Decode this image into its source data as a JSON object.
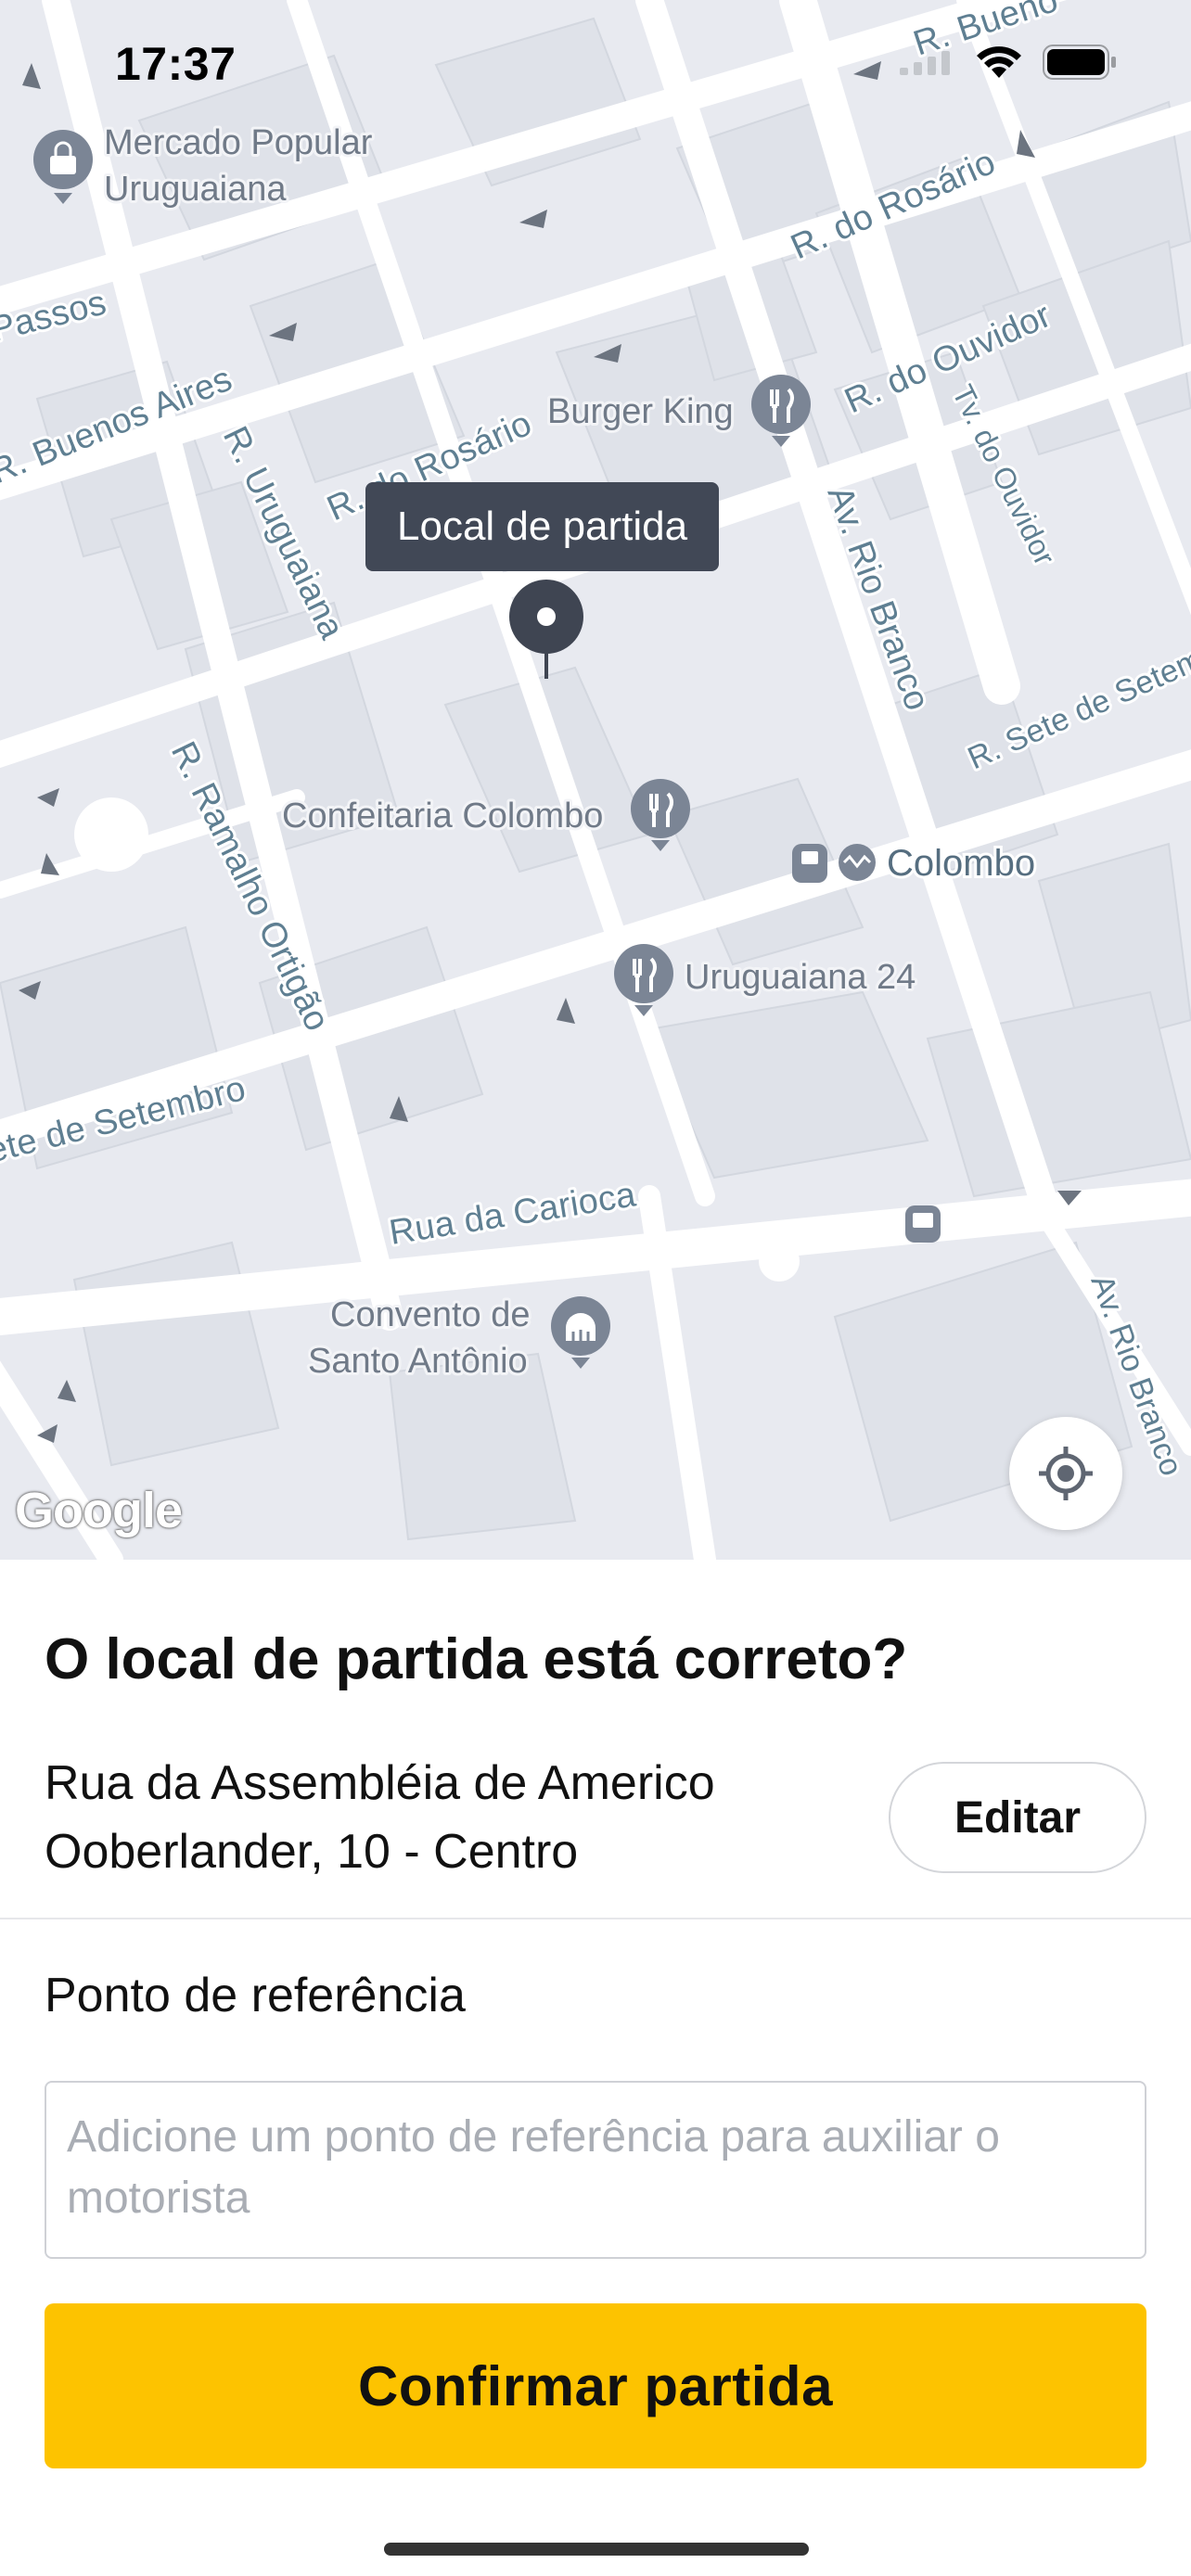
{
  "status_bar": {
    "time": "17:37",
    "icons": [
      "signal-icon",
      "wifi-icon",
      "battery-icon"
    ]
  },
  "map": {
    "streets": {
      "r_buenos_top": "R. Bueno",
      "r_rosario_top": "R. do Rosário",
      "r_ouvidor": "R. do Ouvidor",
      "tv_ouvidor": "Tv. do Ouvidor",
      "passos": "Passos",
      "r_buenos_aires": "R. Buenos Aires",
      "r_uruguaiana": "R. Uruguaiana",
      "r_rosario_mid": "R. do Rosário",
      "av_rio_branco": "Av. Rio Branco",
      "r_sete_right": "R. Sete de Setemb",
      "r_ramalho_ortigao": "R. Ramalho Ortigão",
      "sete_left": "ete de Setembro",
      "rua_da_carioca": "Rua da Carioca",
      "av_rio_branco_bottom": "Av. Rio Branco"
    },
    "pois": {
      "mercado_line1": "Mercado Popular",
      "mercado_line2": "Uruguaiana",
      "burger_king": "Burger King",
      "confeitaria": "Confeitaria Colombo",
      "colombo_station": "Colombo",
      "uruguaiana24": "Uruguaiana 24",
      "convento_line1": "Convento de",
      "convento_line2": "Santo Antônio"
    },
    "pin_callout": "Local de partida",
    "attribution": "Google",
    "locate_icon": "locate-me-icon"
  },
  "sheet": {
    "title": "O local de partida está correto?",
    "address_line1": "Rua da Assembléia de Americo",
    "address_line2": "Ooberlander, 10 - Centro",
    "edit_label": "Editar",
    "reference_label": "Ponto de referência",
    "reference_placeholder": "Adicione um ponto de referência para auxiliar o motorista",
    "reference_value": "",
    "confirm_label": "Confirmar partida"
  },
  "colors": {
    "accent_yellow": "#fdc300",
    "callout_bg": "#414856",
    "map_bg": "#e8eaf0",
    "road": "#ffffff",
    "street_label": "#5f7f92",
    "poi_icon": "#7b8595"
  }
}
